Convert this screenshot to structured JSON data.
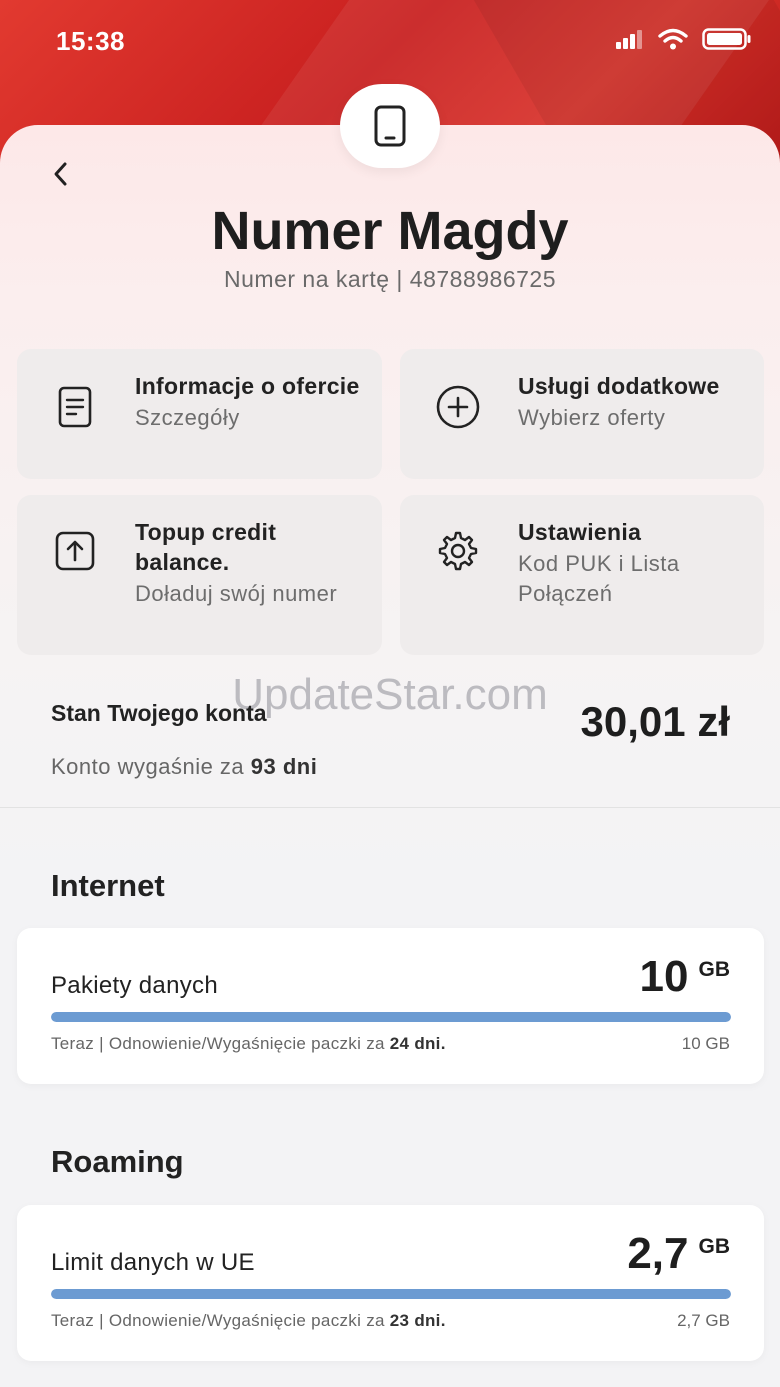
{
  "status": {
    "time": "15:38"
  },
  "header": {
    "title": "Numer Magdy",
    "subtitle": "Numer na kartę | 48788986725"
  },
  "tiles": [
    {
      "name": "Informacje o ofercie",
      "desc": "Szczegóły",
      "icon": "document-icon"
    },
    {
      "name": "Usługi dodatkowe",
      "desc": "Wybierz oferty",
      "icon": "plus-circle-icon"
    },
    {
      "name": "Topup credit balance.",
      "desc": "Doładuj swój numer",
      "icon": "topup-icon"
    },
    {
      "name": "Ustawienia",
      "desc": "Kod PUK i Lista Połączeń",
      "icon": "gear-icon"
    }
  ],
  "balance": {
    "label": "Stan Twojego konta",
    "value": "30,01 zł",
    "expiry_prefix": "Konto wygaśnie za ",
    "expiry_days": "93 dni"
  },
  "watermark": "UpdateStar.com",
  "internet": {
    "section_title": "Internet",
    "label": "Pakiety danych",
    "value": "10",
    "unit": "GB",
    "footer_prefix": "Teraz | Odnowienie/Wygaśnięcie paczki za ",
    "footer_days": "24 dni.",
    "total": "10 GB",
    "fill_percent": 100
  },
  "roaming": {
    "section_title": "Roaming",
    "label": "Limit danych w UE",
    "value": "2,7",
    "unit": "GB",
    "footer_prefix": "Teraz | Odnowienie/Wygaśnięcie paczki za ",
    "footer_days": "23 dni.",
    "total": "2,7 GB",
    "fill_percent": 100
  },
  "colors": {
    "brand_red": "#d42a24",
    "bar_fill": "#6c9bd2"
  }
}
